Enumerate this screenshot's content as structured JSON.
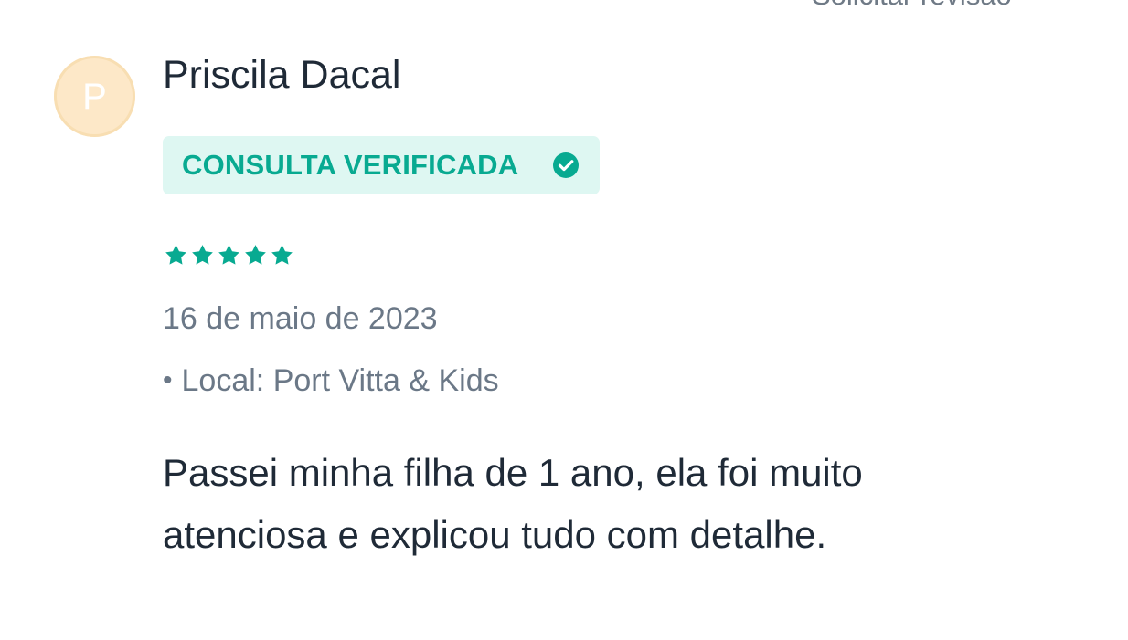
{
  "top": {
    "link_label": "Solicitar revisão"
  },
  "review": {
    "avatar_letter": "P",
    "author_name": "Priscila Dacal",
    "badge_label": "CONSULTA VERIFICADA",
    "rating": {
      "value": 5,
      "max": 5
    },
    "date": "16 de maio de 2023",
    "location_bullet": "•",
    "location_text": "Local: Port Vitta & Kids",
    "comment": "Passei minha filha de 1 ano, ela foi muito atenciosa e explicou tudo com detalhe."
  },
  "icons": {
    "verified": "check-circle-icon",
    "star": "star-icon"
  },
  "colors": {
    "accent": "#08AA91",
    "badge_background": "#DEF7F2",
    "avatar_background": "#FDE8C8",
    "text_primary": "#1F2A37",
    "text_secondary": "#6B7887"
  }
}
